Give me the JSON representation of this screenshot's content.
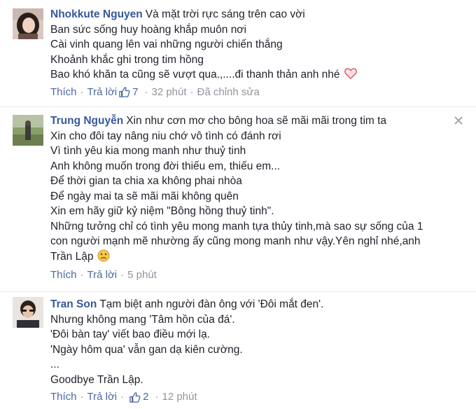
{
  "comments": [
    {
      "author": "Nhokkute Nguyen",
      "lines": [
        "Và mặt trời rực sáng trên cao vời",
        "Ban sức sống huy hoàng khắp muôn nơi",
        "Cài vinh quang lên vai những người chiến thắng",
        "Khoảnh khắc ghi trong tim hồng",
        "Bao khó khăn ta cũng sẽ vượt qua.,....đi thanh thản anh nhé"
      ],
      "like_label": "Thích",
      "reply_label": "Trả lời",
      "like_count": "7",
      "time": "32 phút",
      "edited": "Đã chỉnh sửa",
      "emoji": "heart-icon"
    },
    {
      "author": "Trung Nguyễn",
      "lines": [
        "Xin như cơn mơ cho bông hoa sẽ mãi mãi trong tim ta",
        "Xin cho đôi tay nâng niu chớ vô tình có đánh rơi",
        "Vì tình yêu kia mong manh như thuỷ tinh",
        "Anh không muốn trong đời thiếu em, thiếu em...",
        "Để thời gian ta chia xa không phai nhòa",
        "Để ngày mai ta sẽ mãi mãi không quên",
        "Xin em hãy giữ kỷ niệm \"Bông hồng thuỷ tinh\".",
        "Những tưởng chỉ có tình yêu mong manh tựa thủy tinh,mà sao sự sống của 1",
        "con người mạnh mẽ nhường ấy cũng mong manh như vậy.Yên nghỉ nhé,anh",
        "Trần Lập"
      ],
      "like_label": "Thích",
      "reply_label": "Trả lời",
      "time": "5 phút",
      "emoji": "sad-face-icon"
    },
    {
      "author": "Tran Son",
      "lines": [
        "Tạm biệt anh người đàn ông với 'Đôi mắt đen'.",
        "Nhưng không mang 'Tâm hồn của đá'.",
        "'Đôi bàn tay' viết bao điều mới lạ.",
        "'Ngày hôm qua' vẫn gan dạ kiên cường.",
        "...",
        "Goodbye Trần Lập."
      ],
      "like_label": "Thích",
      "reply_label": "Trả lời",
      "like_count": "2",
      "time": "12 phút"
    }
  ],
  "colors": {
    "link": "#365899",
    "meta": "#90949c",
    "text": "#1d2129",
    "like_blue": "#4b67a1",
    "heart": "#e0535f",
    "sad_face": "#f7c84a"
  }
}
